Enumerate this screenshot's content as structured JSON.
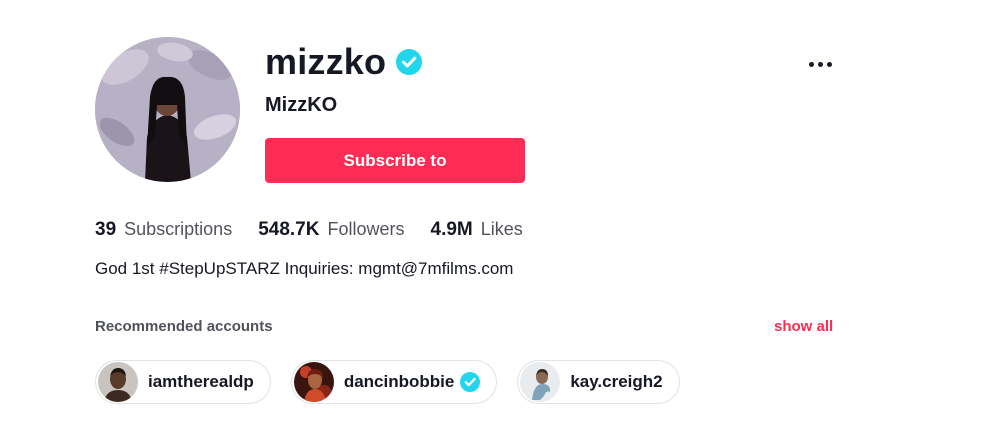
{
  "profile": {
    "username": "mizzko",
    "display_name": "MizzKO",
    "verified": true,
    "subscribe_label": "Subscribe to",
    "bio": "God 1st #StepUpSTARZ Inquiries: mgmt@7mfilms.com"
  },
  "stats": {
    "subscriptions": {
      "value": "39",
      "label": "Subscriptions"
    },
    "followers": {
      "value": "548.7K",
      "label": "Followers"
    },
    "likes": {
      "value": "4.9M",
      "label": "Likes"
    }
  },
  "recommended": {
    "title": "Recommended accounts",
    "show_all_label": "show all",
    "accounts": [
      {
        "name": "iamtherealdp",
        "verified": false
      },
      {
        "name": "dancinbobbie",
        "verified": true
      },
      {
        "name": "kay.creigh2",
        "verified": false
      }
    ]
  },
  "icons": {
    "more": "more-horizontal-icon",
    "verified": "verified-check-icon"
  },
  "colors": {
    "accent": "#fe2c55",
    "verified": "#20d5ec",
    "text": "#161823"
  }
}
